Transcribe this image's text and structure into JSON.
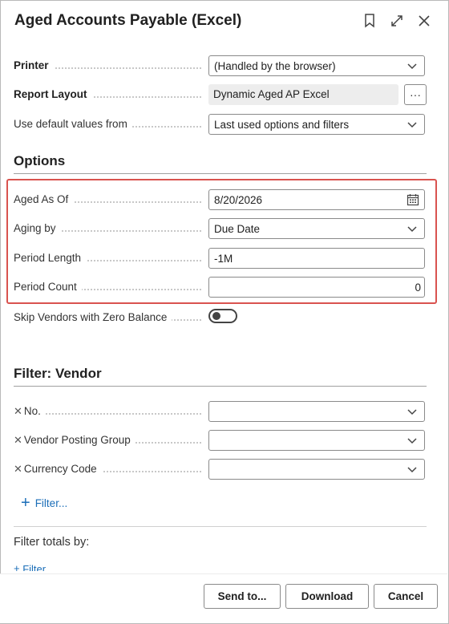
{
  "dialog": {
    "title": "Aged Accounts Payable (Excel)"
  },
  "general": {
    "printer": {
      "label": "Printer",
      "value": "(Handled by the browser)"
    },
    "report_layout": {
      "label": "Report Layout",
      "value": "Dynamic Aged AP Excel",
      "more": "···"
    },
    "defaults": {
      "label": "Use default values from",
      "value": "Last used options and filters"
    }
  },
  "options": {
    "heading": "Options",
    "aged_as_of": {
      "label": "Aged As Of",
      "value": "8/20/2026"
    },
    "aging_by": {
      "label": "Aging by",
      "value": "Due Date"
    },
    "period_length": {
      "label": "Period Length",
      "value": "-1M"
    },
    "period_count": {
      "label": "Period Count",
      "value": "0"
    },
    "skip_zero": {
      "label": "Skip Vendors with Zero Balance",
      "checked": false
    }
  },
  "filter_vendor": {
    "heading": "Filter: Vendor",
    "fields": [
      {
        "label": "No.",
        "value": ""
      },
      {
        "label": "Vendor Posting Group",
        "value": ""
      },
      {
        "label": "Currency Code",
        "value": ""
      }
    ],
    "add_filter": "Filter..."
  },
  "filter_totals": {
    "heading": "Filter totals by:",
    "add_filter_partial": "Filter..."
  },
  "footer": {
    "send_to": "Send to...",
    "download": "Download",
    "cancel": "Cancel"
  },
  "colors": {
    "highlight": "#d9534f",
    "link": "#1b6eb8",
    "readonly_bg": "#ededed"
  },
  "icons": [
    "bookmark-icon",
    "expand-icon",
    "close-icon",
    "chevron-down-icon",
    "calendar-icon",
    "plus-icon"
  ]
}
